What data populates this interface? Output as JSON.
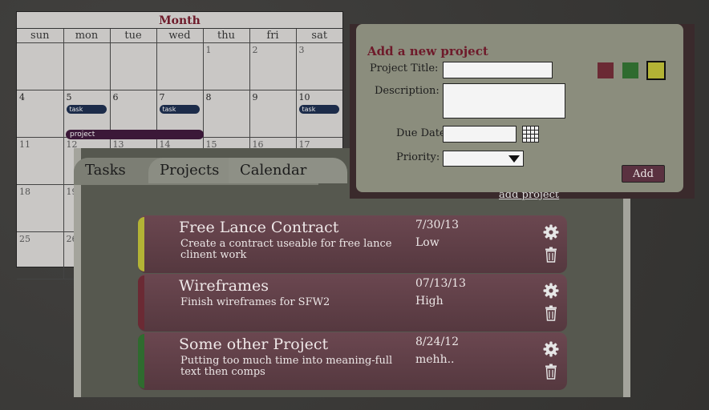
{
  "calendar": {
    "title": "Month",
    "weekdays": [
      "sun",
      "mon",
      "tue",
      "wed",
      "thu",
      "fri",
      "sat"
    ],
    "weeks": [
      [
        "",
        "",
        "",
        "",
        "1",
        "2",
        "3"
      ],
      [
        "4",
        "5",
        "6",
        "7",
        "8",
        "9",
        "10"
      ],
      [
        "11",
        "12",
        "13",
        "14",
        "15",
        "16",
        "17"
      ],
      [
        "18",
        "19",
        "",
        "",
        "",
        "",
        ""
      ],
      [
        "25",
        "26",
        "",
        "",
        "",
        "",
        ""
      ]
    ],
    "task_label": "task",
    "project_label": "project"
  },
  "tabs": {
    "tasks": "Tasks",
    "projects": "Projects",
    "calendar": "Calendar"
  },
  "projects": [
    {
      "title": "Free Lance Contract",
      "description": "Create a contract useable for free lance clinent work",
      "date": "7/30/13",
      "priority": "Low",
      "color": "#b3b335"
    },
    {
      "title": "Wireframes",
      "description": "Finish wireframes for SFW2",
      "date": "07/13/13",
      "priority": "High",
      "color": "#6b2a34"
    },
    {
      "title": "Some other Project",
      "description": "Putting too much time into meaning-full text then comps",
      "date": "8/24/12",
      "priority": "mehh..",
      "color": "#2f6b2f"
    }
  ],
  "dialog": {
    "title": "Add a new project",
    "project_title_label": "Project Title:",
    "project_title_value": "",
    "description_label": "Description:",
    "description_value": "",
    "due_date_label": "Due Date:",
    "due_date_value": "",
    "priority_label": "Priority:",
    "priority_value": "",
    "add_label": "Add",
    "swatch_colors": [
      "#6b2a34",
      "#2f6b2f",
      "#b3b335"
    ],
    "selected_swatch": 2
  },
  "add_project_link": "add project"
}
